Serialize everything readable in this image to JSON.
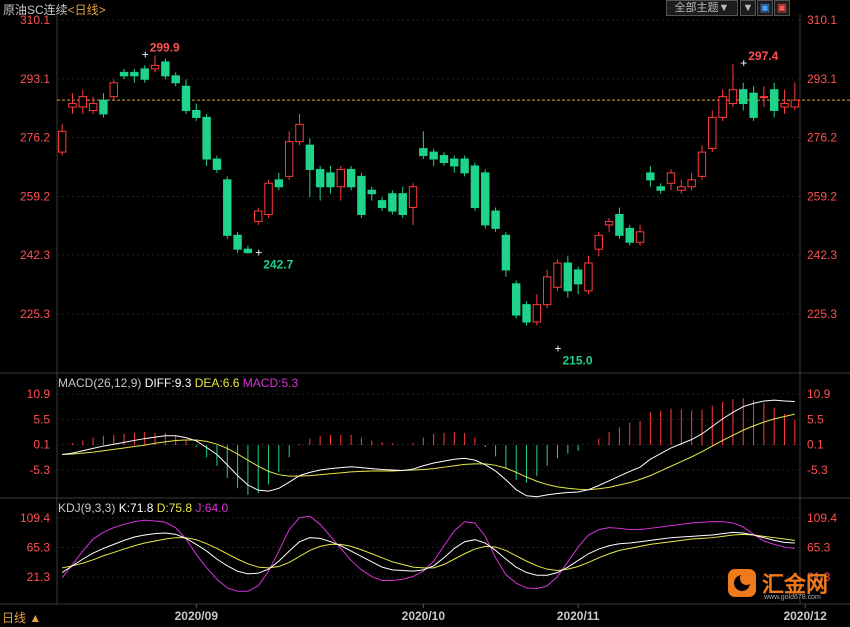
{
  "header": {
    "instrument": "原油SC连续",
    "period_tag": "<日线>",
    "theme_button": "全部主题▼",
    "btn_a": "▼",
    "btn_b": "▣",
    "btn_c": "▣"
  },
  "footer": {
    "period_label": "日线 ▲"
  },
  "logo": {
    "name": "汇金网",
    "url": "www.gold678.com",
    "color": "#f07a1a"
  },
  "colors": {
    "up": "#ff3b3b",
    "down": "#1fd38a",
    "diff": "#ffffff",
    "dea": "#e8e84a",
    "j": "#d633d6"
  },
  "chart_data": [
    {
      "type": "candlestick",
      "title": "原油SC连续",
      "y_ticks": [
        "310.1",
        "293.1",
        "276.2",
        "259.2",
        "242.3",
        "225.3"
      ],
      "ylim": [
        208.0,
        310.1
      ],
      "reference_line": 287.0,
      "annotations": [
        {
          "label": "299.9",
          "index": 8,
          "value": 299.9,
          "pos": "top"
        },
        {
          "label": "242.7",
          "index": 19,
          "value": 242.7,
          "pos": "bottom"
        },
        {
          "label": "215.0",
          "index": 48,
          "value": 215.0,
          "pos": "bottom"
        },
        {
          "label": "297.4",
          "index": 66,
          "value": 297.4,
          "pos": "top"
        }
      ],
      "x_ticks": [
        {
          "label": "2020/09",
          "index": 13
        },
        {
          "label": "2020/10",
          "index": 35
        },
        {
          "label": "2020/11",
          "index": 50
        },
        {
          "label": "2020/12",
          "index": 72
        }
      ],
      "candles": [
        [
          272,
          278,
          280,
          271
        ],
        [
          285,
          286,
          289,
          283
        ],
        [
          285,
          288,
          290,
          283
        ],
        [
          284,
          286,
          288,
          283
        ],
        [
          287,
          283,
          289,
          282
        ],
        [
          288,
          292,
          293,
          287
        ],
        [
          295,
          294,
          296,
          293
        ],
        [
          295,
          294,
          296,
          292
        ],
        [
          296,
          293,
          297,
          292
        ],
        [
          296,
          297,
          299.9,
          295
        ],
        [
          298,
          294,
          299,
          293
        ],
        [
          294,
          292,
          295,
          291
        ],
        [
          291,
          284,
          293,
          283
        ],
        [
          284,
          282,
          286,
          281
        ],
        [
          282,
          270,
          283,
          268
        ],
        [
          270,
          267,
          271,
          266
        ],
        [
          264,
          248,
          265,
          247
        ],
        [
          248,
          244,
          249,
          243
        ],
        [
          244,
          243,
          245,
          242.7
        ],
        [
          252,
          255,
          256,
          251
        ],
        [
          254,
          263,
          264,
          253
        ],
        [
          264,
          262,
          266,
          261
        ],
        [
          265,
          275,
          278,
          264
        ],
        [
          275,
          280,
          283,
          274
        ],
        [
          274,
          267,
          276,
          259
        ],
        [
          267,
          262,
          268,
          258
        ],
        [
          266,
          262,
          268,
          260
        ],
        [
          262,
          267,
          268,
          258
        ],
        [
          267,
          262,
          268,
          261
        ],
        [
          265,
          254,
          266,
          253
        ],
        [
          261,
          260,
          262,
          258
        ],
        [
          258,
          256,
          259,
          255
        ],
        [
          260,
          255,
          261,
          254
        ],
        [
          260,
          254,
          262,
          253
        ],
        [
          256,
          262,
          263,
          251
        ],
        [
          273,
          271,
          278,
          270
        ],
        [
          272,
          270,
          273,
          268
        ],
        [
          271,
          269,
          272,
          268
        ],
        [
          270,
          268,
          271,
          266
        ],
        [
          270,
          266,
          271,
          265
        ],
        [
          268,
          256,
          269,
          255
        ],
        [
          266,
          251,
          267,
          250
        ],
        [
          255,
          250,
          256,
          249
        ],
        [
          248,
          238,
          249,
          236
        ],
        [
          234,
          225,
          235,
          224
        ],
        [
          228,
          223,
          229,
          222
        ],
        [
          223,
          228,
          231,
          222
        ],
        [
          228,
          236,
          238,
          227
        ],
        [
          233,
          240,
          241,
          232
        ],
        [
          240,
          232,
          242,
          230
        ],
        [
          238,
          234,
          239,
          231
        ],
        [
          232,
          240,
          242,
          231
        ],
        [
          244,
          248,
          249,
          242
        ],
        [
          251,
          252,
          253,
          249
        ],
        [
          254,
          248,
          256,
          247
        ],
        [
          250,
          246,
          251,
          245
        ],
        [
          246,
          249,
          251,
          245
        ],
        [
          266,
          264,
          268,
          262
        ],
        [
          262,
          261,
          263,
          260
        ],
        [
          263,
          266,
          267,
          261
        ],
        [
          261,
          262,
          264,
          260
        ],
        [
          262,
          264,
          266,
          261
        ],
        [
          265,
          272,
          274,
          264
        ],
        [
          273,
          282,
          284,
          272
        ],
        [
          282,
          288,
          290,
          281
        ],
        [
          286,
          290,
          297.4,
          285
        ],
        [
          290,
          286,
          292,
          284
        ],
        [
          289,
          282,
          291,
          281
        ],
        [
          288,
          288,
          291,
          285
        ],
        [
          290,
          284,
          292,
          282
        ],
        [
          285,
          286,
          290,
          283
        ],
        [
          285,
          287,
          292,
          284
        ]
      ]
    },
    {
      "type": "macd",
      "params": "MACD(26,12,9)",
      "diff_label": "DIFF:9.3",
      "dea_label": "DEA:6.6",
      "macd_label": "MACD:5.3",
      "y_ticks": [
        "10.9",
        "5.5",
        "0.1",
        "-5.3"
      ],
      "ylim": [
        -11.0,
        12.5
      ],
      "diff": [
        -2.0,
        -1.7,
        -1.2,
        -0.7,
        -0.2,
        0.2,
        0.6,
        1.0,
        1.4,
        1.7,
        2.0,
        2.0,
        1.6,
        0.9,
        -0.5,
        -2.0,
        -4.2,
        -6.5,
        -8.5,
        -9.6,
        -9.8,
        -9.2,
        -7.9,
        -6.5,
        -5.8,
        -5.3,
        -5.0,
        -4.8,
        -4.6,
        -4.8,
        -5.0,
        -5.2,
        -5.3,
        -5.4,
        -5.1,
        -4.4,
        -3.8,
        -3.4,
        -3.0,
        -2.8,
        -3.2,
        -4.2,
        -5.5,
        -7.4,
        -9.5,
        -10.8,
        -11.0,
        -10.6,
        -10.3,
        -10.1,
        -10.0,
        -9.5,
        -8.6,
        -7.6,
        -6.6,
        -5.6,
        -4.7,
        -3.0,
        -1.8,
        -0.6,
        0.3,
        1.2,
        2.4,
        4.0,
        5.6,
        7.0,
        8.2,
        8.9,
        9.4,
        9.6,
        9.4,
        9.3
      ],
      "dea": [
        -2.0,
        -1.9,
        -1.7,
        -1.5,
        -1.2,
        -0.9,
        -0.6,
        -0.3,
        0.0,
        0.4,
        0.7,
        1.0,
        1.1,
        1.1,
        0.8,
        0.2,
        -0.7,
        -1.9,
        -3.2,
        -4.5,
        -5.6,
        -6.3,
        -6.6,
        -6.6,
        -6.5,
        -6.3,
        -6.1,
        -5.9,
        -5.7,
        -5.6,
        -5.5,
        -5.5,
        -5.5,
        -5.4,
        -5.3,
        -5.2,
        -5.0,
        -4.7,
        -4.4,
        -4.1,
        -4.0,
        -4.0,
        -4.3,
        -4.9,
        -5.8,
        -6.8,
        -7.7,
        -8.4,
        -8.9,
        -9.2,
        -9.4,
        -9.5,
        -9.3,
        -9.0,
        -8.5,
        -8.0,
        -7.3,
        -6.5,
        -5.5,
        -4.5,
        -3.5,
        -2.5,
        -1.4,
        -0.2,
        1.0,
        2.1,
        3.2,
        4.1,
        4.9,
        5.6,
        6.1,
        6.6
      ]
    },
    {
      "type": "kdj",
      "params": "KDJ(9,3,3)",
      "k_label": "K:71.8",
      "d_label": "D:75.8",
      "j_label": "J:64.0",
      "y_ticks": [
        "109.4",
        "65.3",
        "21.3"
      ],
      "ylim": [
        -10.0,
        118.0
      ],
      "k": [
        28,
        38,
        48,
        57,
        64,
        70,
        76,
        81,
        84,
        86,
        87,
        85,
        79,
        70,
        60,
        48,
        38,
        30,
        26,
        27,
        33,
        45,
        60,
        74,
        80,
        79,
        74,
        68,
        60,
        52,
        44,
        36,
        32,
        31,
        30,
        32,
        38,
        50,
        64,
        74,
        77,
        72,
        61,
        48,
        36,
        28,
        24,
        24,
        28,
        36,
        46,
        56,
        63,
        68,
        71,
        72,
        74,
        76,
        78,
        80,
        81,
        82,
        83,
        84,
        86,
        88,
        87,
        84,
        80,
        76,
        73,
        72
      ],
      "d": [
        35,
        38,
        42,
        47,
        53,
        58,
        63,
        68,
        72,
        75,
        78,
        80,
        80,
        77,
        71,
        64,
        56,
        48,
        41,
        36,
        35,
        37,
        43,
        52,
        61,
        67,
        70,
        70,
        67,
        62,
        56,
        50,
        44,
        40,
        36,
        35,
        35,
        40,
        48,
        56,
        63,
        67,
        66,
        61,
        53,
        45,
        38,
        33,
        31,
        33,
        37,
        43,
        50,
        56,
        61,
        64,
        67,
        70,
        72,
        74,
        76,
        78,
        79,
        80,
        82,
        84,
        85,
        84,
        82,
        80,
        78,
        76
      ],
      "j": [
        20,
        40,
        60,
        78,
        88,
        95,
        100,
        104,
        106,
        105,
        103,
        95,
        78,
        55,
        35,
        18,
        5,
        0,
        0,
        8,
        30,
        60,
        92,
        110,
        112,
        100,
        82,
        64,
        46,
        32,
        22,
        16,
        16,
        18,
        22,
        30,
        45,
        68,
        90,
        104,
        102,
        82,
        50,
        25,
        12,
        5,
        4,
        8,
        22,
        44,
        66,
        84,
        92,
        95,
        94,
        92,
        92,
        94,
        96,
        98,
        100,
        102,
        103,
        104,
        104,
        102,
        96,
        85,
        75,
        70,
        66,
        64
      ]
    }
  ]
}
